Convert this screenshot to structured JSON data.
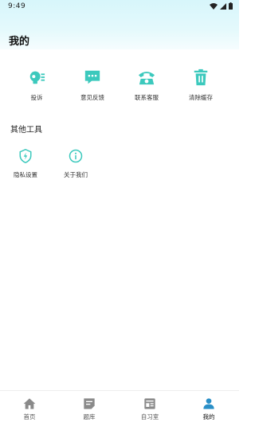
{
  "status_bar": {
    "time": "9:49"
  },
  "page": {
    "title": "我的"
  },
  "top_actions": [
    {
      "label": "投诉",
      "icon": "complaint-agent-icon"
    },
    {
      "label": "意见反馈",
      "icon": "feedback-chat-icon"
    },
    {
      "label": "联系客服",
      "icon": "telephone-icon"
    },
    {
      "label": "清除缓存",
      "icon": "trash-icon"
    }
  ],
  "other_tools": {
    "title": "其他工具",
    "items": [
      {
        "label": "隐私设置",
        "icon": "shield-icon"
      },
      {
        "label": "关于我们",
        "icon": "info-icon"
      }
    ]
  },
  "tabbar": [
    {
      "label": "首页",
      "icon": "home-icon",
      "active": false
    },
    {
      "label": "题库",
      "icon": "question-bank-icon",
      "active": false
    },
    {
      "label": "自习室",
      "icon": "study-room-icon",
      "active": false
    },
    {
      "label": "我的",
      "icon": "person-icon",
      "active": true
    }
  ],
  "colors": {
    "accent": "#3cc9bd",
    "tab_inactive": "#8a8a8a",
    "tab_active": "#2a8fc7"
  }
}
